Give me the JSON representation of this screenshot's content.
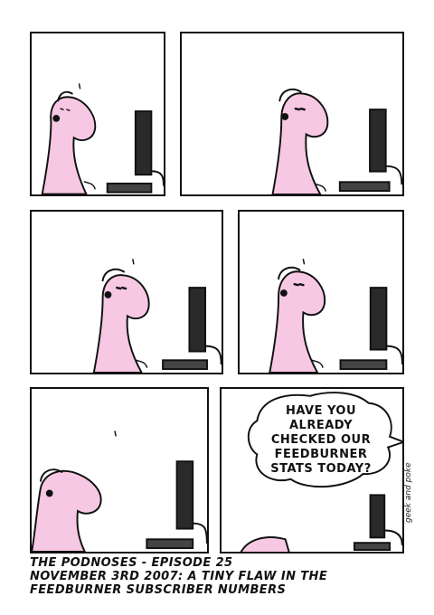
{
  "comic": {
    "bubble_lines": [
      "HAVE YOU",
      "ALREADY",
      "CHECKED OUR",
      "FEEDBURNER",
      "STATS TODAY?"
    ],
    "caption_lines": [
      "THE PODNOSES - EPISODE 25",
      "NOVEMBER 3RD 2007: A TINY FLAW IN THE",
      "FEEDBURNER SUBSCRIBER NUMBERS"
    ],
    "signature": "geek and poke",
    "colors": {
      "skin": "#f7c8e4",
      "ink": "#111111",
      "monitor": "#2a2a2a"
    }
  }
}
